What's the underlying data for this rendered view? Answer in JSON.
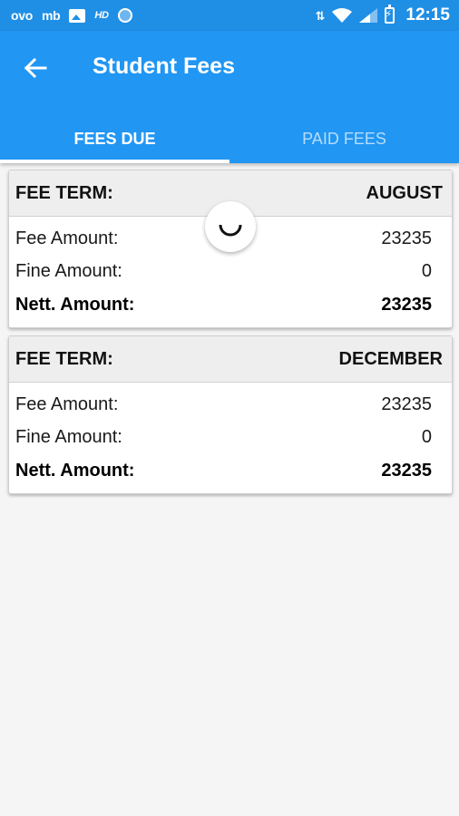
{
  "status_bar": {
    "left_items": [
      "ovo",
      "mb",
      "HD"
    ],
    "icons": [
      "image-icon",
      "circle-icon",
      "data-arrows-icon",
      "wifi-icon",
      "signal-icon",
      "battery-charging-icon"
    ],
    "time": "12:15"
  },
  "app_bar": {
    "title": "Student Fees",
    "back_icon": "arrow-left-icon",
    "color": "#2196f3"
  },
  "tabs": [
    {
      "label": "FEES DUE",
      "active": true
    },
    {
      "label": "PAID FEES",
      "active": false
    }
  ],
  "fees": [
    {
      "term_label": "FEE TERM:",
      "term": "AUGUST",
      "rows": [
        {
          "label": "Fee Amount:",
          "value": "23235"
        },
        {
          "label": "Fine Amount:",
          "value": "0"
        },
        {
          "label": "Nett. Amount:",
          "value": "23235"
        }
      ]
    },
    {
      "term_label": "FEE TERM:",
      "term": "DECEMBER",
      "rows": [
        {
          "label": "Fee Amount:",
          "value": "23235"
        },
        {
          "label": "Fine Amount:",
          "value": "0"
        },
        {
          "label": "Nett. Amount:",
          "value": "23235"
        }
      ]
    }
  ],
  "loading_indicator": "refresh-spinner-icon"
}
